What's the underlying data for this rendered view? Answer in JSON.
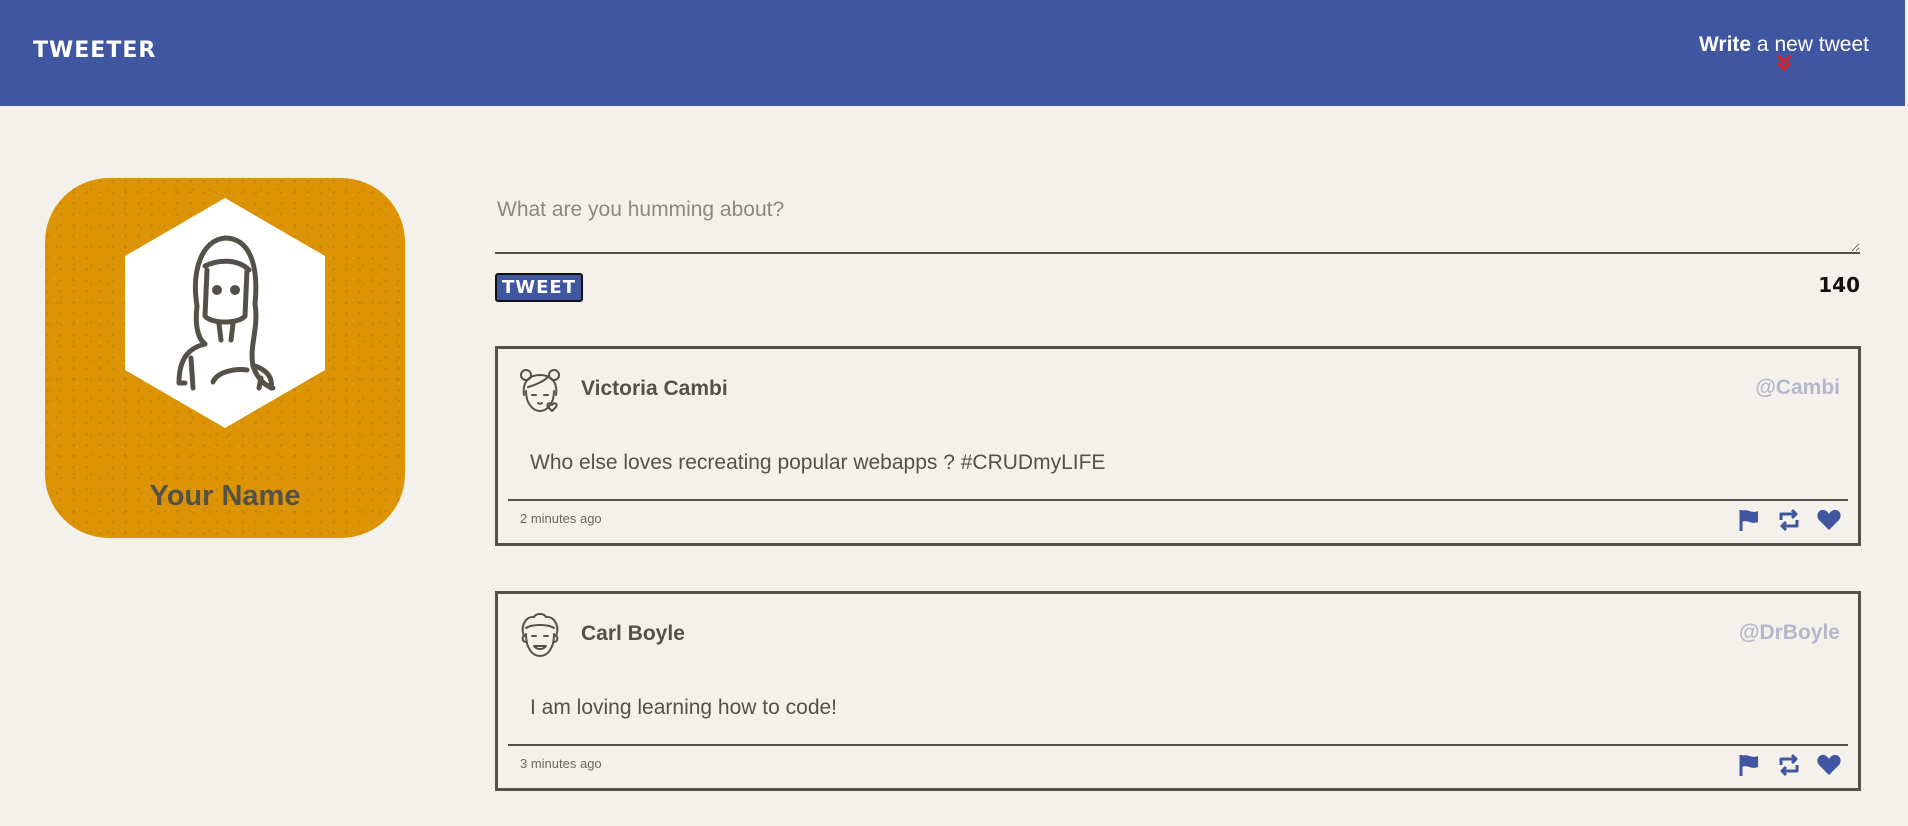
{
  "nav": {
    "brand": "TWEETER",
    "compose_bold": "Write",
    "compose_rest": " a new tweet"
  },
  "profile": {
    "name": "Your Name"
  },
  "composer": {
    "placeholder": "What are you humming about?",
    "button_label": "TWEET",
    "counter": "140"
  },
  "tweets": [
    {
      "name": "Victoria Cambi",
      "handle": "@Cambi",
      "content": "Who else loves recreating popular webapps ? #CRUDmyLIFE",
      "time": "2 minutes ago"
    },
    {
      "name": "Carl Boyle",
      "handle": "@DrBoyle",
      "content": "I am loving learning how to code!",
      "time": "3 minutes ago"
    }
  ],
  "colors": {
    "navbar": "#4056a1",
    "background": "#f4f1ec",
    "profile_card": "#dc9404",
    "accent_icon": "#4056a1",
    "chevron": "#e01b22",
    "handle": "#b5b8c8",
    "text": "#545149"
  },
  "icons": {
    "compose_toggle": "double-chevron-down-icon",
    "actions": [
      "flag-icon",
      "retweet-icon",
      "heart-icon"
    ]
  }
}
